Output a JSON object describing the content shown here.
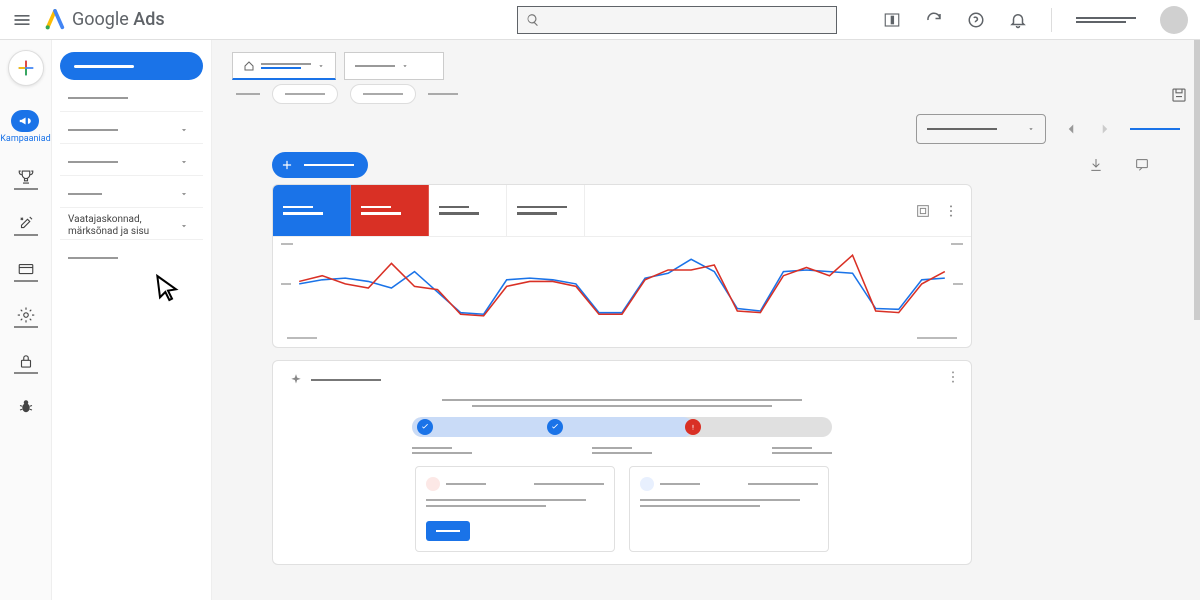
{
  "header": {
    "product": "Google",
    "product_suffix": "Ads",
    "search_placeholder": ""
  },
  "rail": {
    "active_label": "Kampaaniad"
  },
  "sidenav": {
    "items": [
      {
        "label": ""
      },
      {
        "label": ""
      },
      {
        "label": ""
      },
      {
        "label": ""
      },
      {
        "label": "Vaatajaskonnad, märksõnad ja sisu"
      },
      {
        "label": ""
      }
    ]
  },
  "breadcrumb": {
    "selector1": "",
    "selector2": ""
  },
  "metrics": {
    "tabs": [
      "",
      "",
      "",
      ""
    ]
  },
  "chart_data": {
    "type": "line",
    "title": "",
    "xlabel": "",
    "ylabel": "",
    "ylim": [
      0,
      100
    ],
    "x": [
      0,
      1,
      2,
      3,
      4,
      5,
      6,
      7,
      8,
      9,
      10,
      11,
      12,
      13,
      14,
      15,
      16,
      17,
      18,
      19,
      20,
      21,
      22,
      23,
      24,
      25,
      26,
      27,
      28
    ],
    "series": [
      {
        "name": "metric_blue",
        "color": "#1a73e8",
        "values": [
          55,
          60,
          62,
          58,
          50,
          70,
          45,
          20,
          18,
          60,
          62,
          60,
          55,
          20,
          20,
          62,
          68,
          85,
          70,
          25,
          22,
          70,
          72,
          70,
          68,
          25,
          24,
          60,
          62
        ]
      },
      {
        "name": "metric_red",
        "color": "#d93025",
        "values": [
          58,
          65,
          55,
          50,
          80,
          52,
          48,
          18,
          16,
          52,
          58,
          58,
          52,
          18,
          18,
          60,
          72,
          72,
          78,
          22,
          20,
          65,
          75,
          65,
          90,
          22,
          20,
          55,
          70
        ]
      }
    ]
  },
  "recommendation": {
    "progress_pct": 67,
    "steps": [
      {
        "state": "done",
        "pos_pct": 3
      },
      {
        "state": "done",
        "pos_pct": 34
      },
      {
        "state": "warn",
        "pos_pct": 67
      }
    ],
    "card1_button": "",
    "card2_button": ""
  }
}
